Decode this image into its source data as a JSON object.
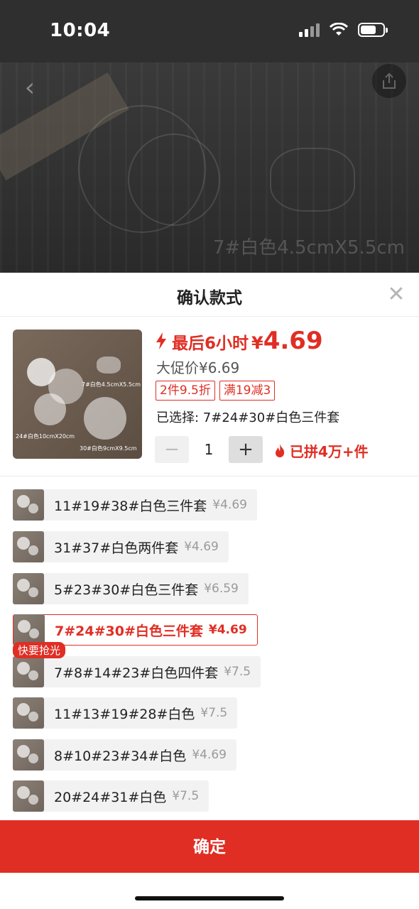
{
  "status_bar": {
    "time": "10:04"
  },
  "product_banner": {
    "caption": "7#白色4.5cmX5.5cm"
  },
  "sheet": {
    "title": "确认款式",
    "close_icon": "close-icon",
    "thumb_labels": [
      "7#白色4.5cmX5.5cm",
      "24#白色10cmX20cm",
      "30#白色9cmX9.5cm"
    ],
    "urgency": "最后6小时",
    "currency": "¥",
    "price": "4.69",
    "promo_price": "大促价¥6.69",
    "tags": [
      "2件9.5折",
      "满19减3"
    ],
    "selected": "已选择: 7#24#30#白色三件套",
    "quantity": "1",
    "minus": "−",
    "plus": "+",
    "joined": "已拼4万+件"
  },
  "options": [
    {
      "name": "11#19#38#白色三件套",
      "price": "¥4.69"
    },
    {
      "name": "31#37#白色两件套",
      "price": "¥4.69"
    },
    {
      "name": "5#23#30#白色三件套",
      "price": "¥6.59"
    },
    {
      "name": "7#24#30#白色三件套",
      "price": "¥4.69",
      "selected": true
    },
    {
      "name": "7#8#14#23#白色四件套",
      "price": "¥7.5",
      "badge": "快要抢光"
    },
    {
      "name": "11#13#19#28#白色",
      "price": "¥7.5"
    },
    {
      "name": "8#10#23#34#白色",
      "price": "¥4.69"
    },
    {
      "name": "20#24#31#白色",
      "price": "¥7.5"
    }
  ],
  "confirm_label": "确定",
  "colors": {
    "accent": "#e02e24",
    "option_bg": "#f2f2f2",
    "status_bg": "#2f2f2f"
  }
}
